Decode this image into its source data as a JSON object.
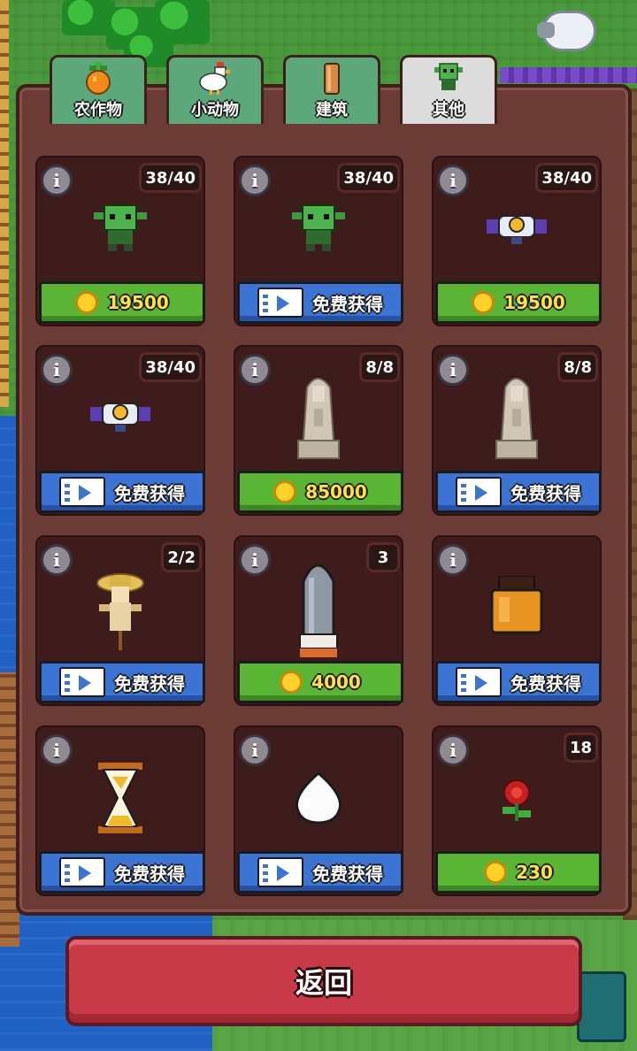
{
  "tabs": [
    {
      "label": "农作物",
      "icon": "crop-icon",
      "active": false
    },
    {
      "label": "小动物",
      "icon": "chicken-icon",
      "active": false
    },
    {
      "label": "建筑",
      "icon": "building-icon",
      "active": false
    },
    {
      "label": "其他",
      "icon": "goblin-icon",
      "active": true
    }
  ],
  "info_symbol": "i",
  "items": [
    {
      "name": "goblin",
      "icon": "goblin-icon",
      "count": "38/40",
      "button": {
        "type": "coin",
        "label": "19500"
      }
    },
    {
      "name": "goblin",
      "icon": "goblin-icon",
      "count": "38/40",
      "button": {
        "type": "video",
        "label": "免费获得"
      }
    },
    {
      "name": "drone",
      "icon": "drone-icon",
      "count": "38/40",
      "button": {
        "type": "coin",
        "label": "19500"
      }
    },
    {
      "name": "drone",
      "icon": "drone-icon",
      "count": "38/40",
      "button": {
        "type": "video",
        "label": "免费获得"
      }
    },
    {
      "name": "statue",
      "icon": "praying-statue-icon",
      "count": "8/8",
      "button": {
        "type": "coin",
        "label": "85000"
      }
    },
    {
      "name": "statue",
      "icon": "praying-statue-icon",
      "count": "8/8",
      "button": {
        "type": "video",
        "label": "免费获得"
      }
    },
    {
      "name": "scarecrow",
      "icon": "scarecrow-icon",
      "count": "2/2",
      "button": {
        "type": "video",
        "label": "免费获得"
      }
    },
    {
      "name": "rocket",
      "icon": "capsule-icon",
      "count": "3",
      "button": {
        "type": "coin",
        "label": "4000"
      }
    },
    {
      "name": "sack",
      "icon": "grain-sack-icon",
      "count": "",
      "button": {
        "type": "video",
        "label": "免费获得"
      }
    },
    {
      "name": "hourglass",
      "icon": "hourglass-icon",
      "count": "",
      "button": {
        "type": "video",
        "label": "免费获得"
      }
    },
    {
      "name": "egg",
      "icon": "egg-icon",
      "count": "",
      "button": {
        "type": "video",
        "label": "免费获得"
      }
    },
    {
      "name": "rose",
      "icon": "rose-icon",
      "count": "18",
      "button": {
        "type": "coin",
        "label": "230"
      }
    }
  ],
  "back_button": {
    "label": "返回"
  }
}
